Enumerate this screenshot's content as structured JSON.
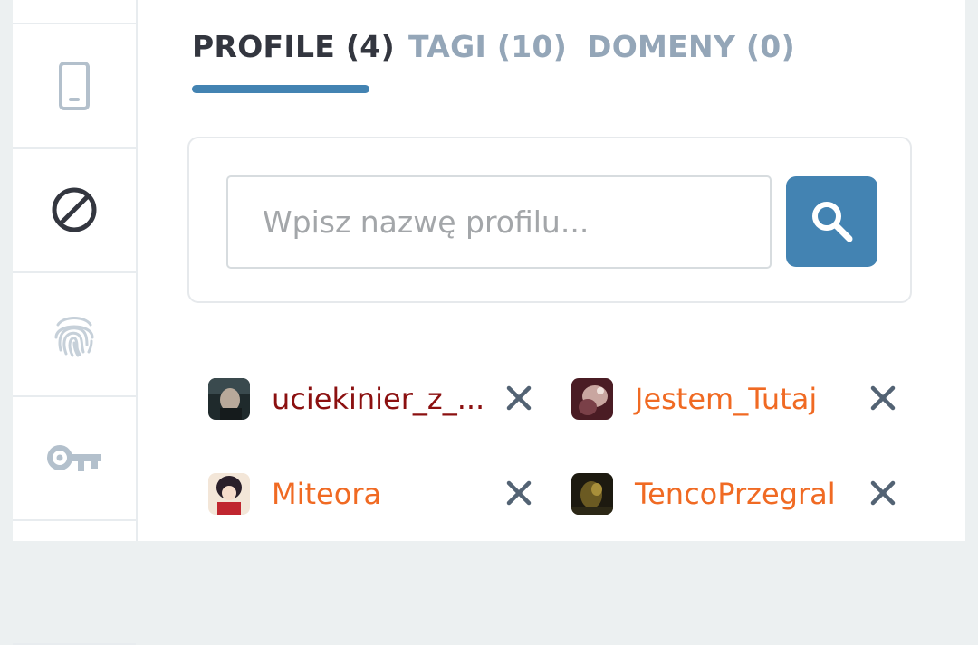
{
  "tabs": [
    {
      "label": "PROFILE (4)",
      "active": true
    },
    {
      "label": "TAGI (10)",
      "active": false
    },
    {
      "label": "DOMENY (0)",
      "active": false
    }
  ],
  "search": {
    "placeholder": "Wpisz nazwę profilu..."
  },
  "sidebar": {
    "icons": [
      "phone-icon",
      "block-icon",
      "fingerprint-icon",
      "key-icon"
    ],
    "active_icon": "block-icon"
  },
  "profiles": [
    {
      "name": "uciekinier_z_...",
      "color": "#8b1010"
    },
    {
      "name": "Jestem_Tutaj",
      "color": "#f06a23"
    },
    {
      "name": "Miteora",
      "color": "#f06a23"
    },
    {
      "name": "TencoPrzegral",
      "color": "#f06a23"
    }
  ],
  "colors": {
    "accent": "#4383b2",
    "tab_active": "#33363f",
    "tab_inactive": "#94a6b8",
    "icon_muted": "#b3c0cc",
    "remove_icon": "#536374"
  }
}
